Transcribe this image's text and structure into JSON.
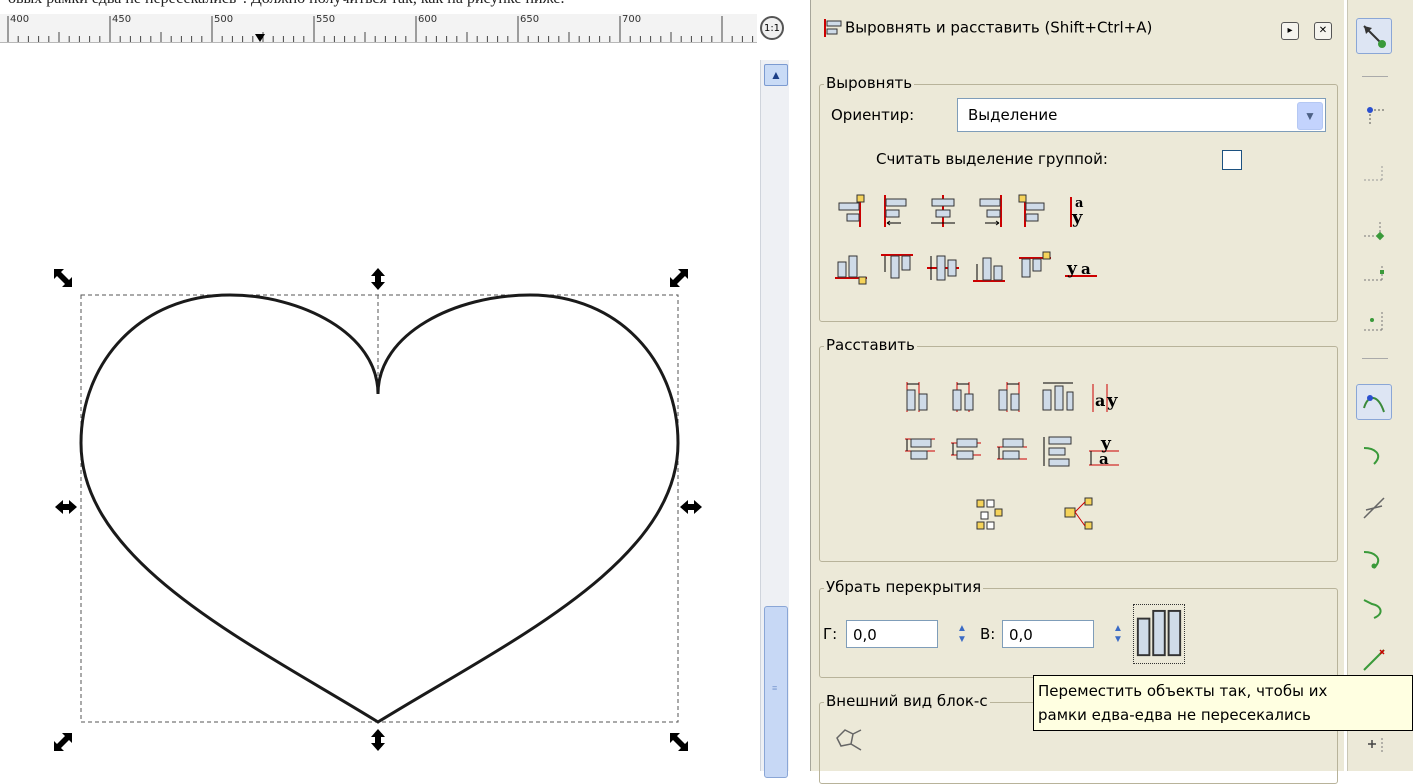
{
  "caption": "овых рамки едва не пересекались\". Должно получиться так, как на рисунке ниже.",
  "ruler": {
    "labels": [
      "400",
      "450",
      "500",
      "550",
      "600",
      "650",
      "700"
    ]
  },
  "zoom_label": "1:1",
  "dialog": {
    "title": "Выровнять и расставить (Shift+Ctrl+A)",
    "align": {
      "legend": "Выровнять",
      "relative_label": "Ориентир:",
      "relative_value": "Выделение",
      "group_label": "Считать выделение группой:"
    },
    "distribute": {
      "legend": "Расставить"
    },
    "overlap": {
      "legend": "Убрать перекрытия",
      "h_label": "Г:",
      "h_value": "0,0",
      "v_label": "В:",
      "v_value": "0,0"
    },
    "connector": {
      "legend": "Внешний вид блок-с"
    }
  },
  "tooltip": {
    "line1": "Переместить объекты так, чтобы их",
    "line2": "рамки едва-едва не пересекались"
  },
  "colors": {
    "dialog_bg": "#ece9d8",
    "accent_red": "#cc0000",
    "box_fill": "#cfdbe8",
    "box_yellow": "#f5d35a"
  }
}
